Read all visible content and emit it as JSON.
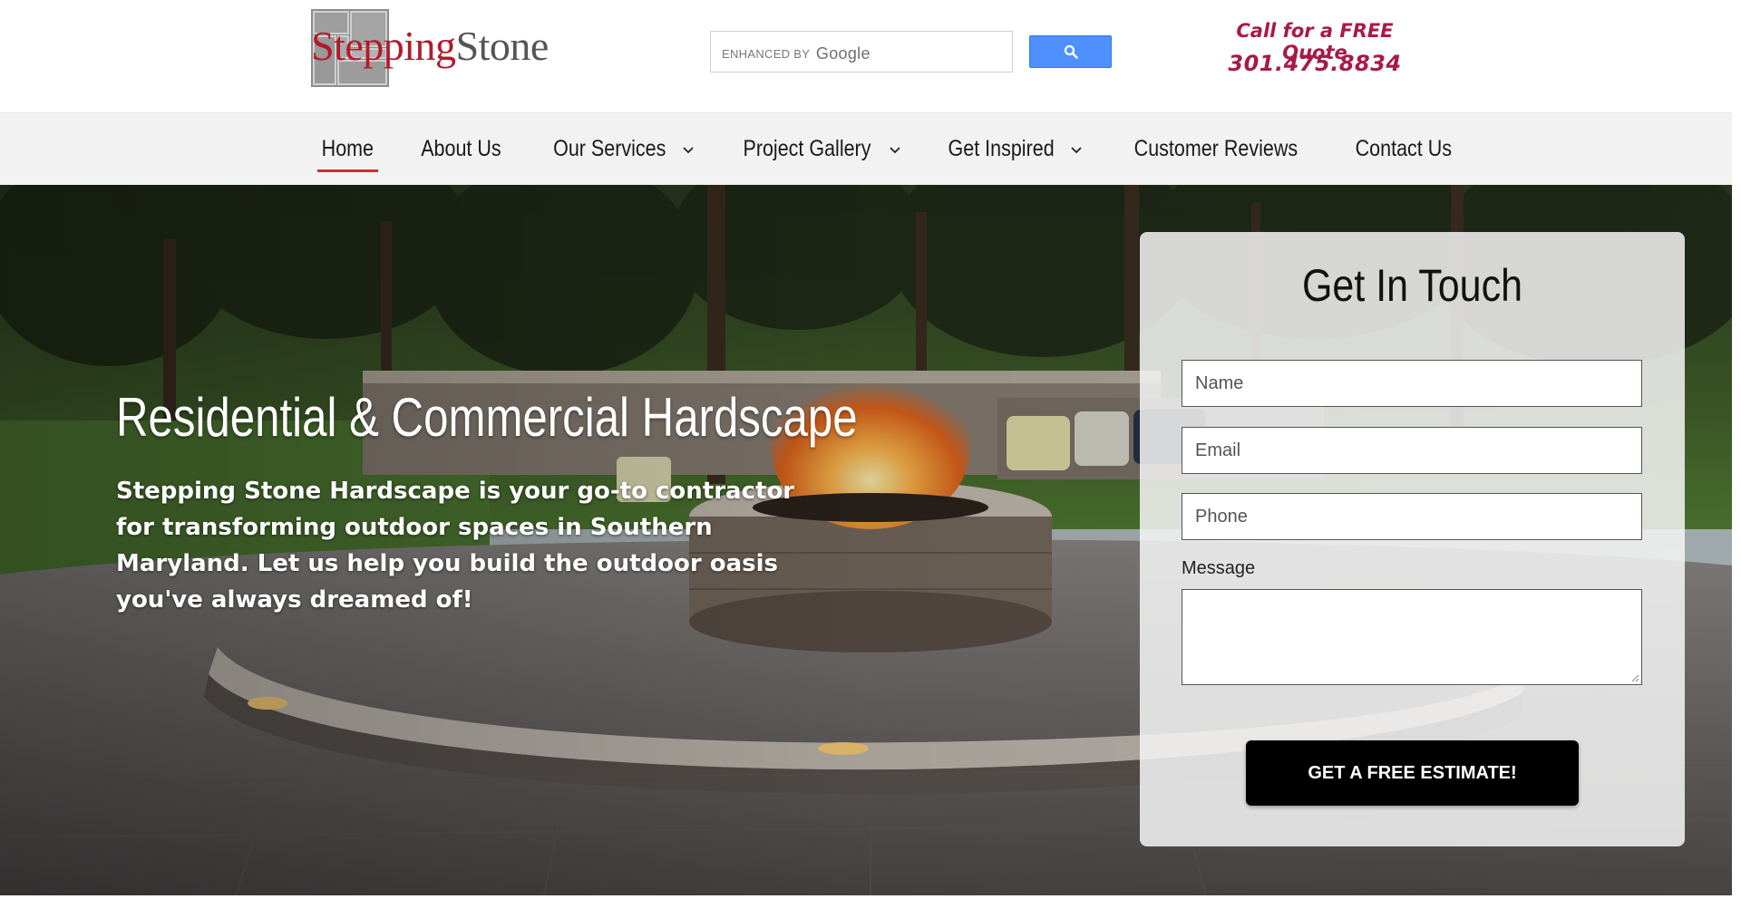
{
  "header": {
    "logo_text_part1": "Stepping",
    "logo_text_part2": "Stone",
    "search": {
      "placeholder_prefix": "ENHANCED BY",
      "placeholder_brand": "Google"
    },
    "quote_title": "Call for a FREE Quote",
    "quote_phone": "301.475.8834"
  },
  "nav": {
    "items": [
      {
        "label": "Home",
        "active": true,
        "dropdown": false
      },
      {
        "label": "About Us",
        "active": false,
        "dropdown": false
      },
      {
        "label": "Our Services",
        "active": false,
        "dropdown": true
      },
      {
        "label": "Project Gallery",
        "active": false,
        "dropdown": true
      },
      {
        "label": "Get Inspired",
        "active": false,
        "dropdown": true
      },
      {
        "label": "Customer Reviews",
        "active": false,
        "dropdown": false
      },
      {
        "label": "Contact Us",
        "active": false,
        "dropdown": false
      }
    ]
  },
  "hero": {
    "title": "Residential & Commercial Hardscape",
    "subtitle": "Stepping Stone Hardscape is your go-to contractor for transforming outdoor spaces in Southern Maryland. Let us help you build the outdoor oasis you've always dreamed of!"
  },
  "form": {
    "title": "Get In Touch",
    "name_placeholder": "Name",
    "email_placeholder": "Email",
    "phone_placeholder": "Phone",
    "message_label": "Message",
    "submit_label": "GET A FREE ESTIMATE!"
  },
  "colors": {
    "brand_red": "#b4192b",
    "quote_color": "#a8194a",
    "search_button": "#4d90fe",
    "nav_underline": "#d32f2f"
  }
}
